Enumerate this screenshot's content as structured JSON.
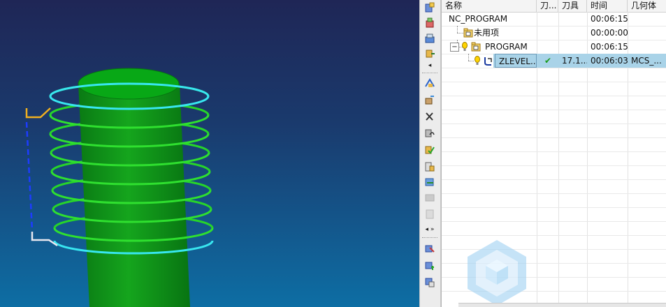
{
  "navigator": {
    "columns": [
      "名称",
      "刀...",
      "刀具",
      "时间",
      "几何体"
    ],
    "rows": [
      {
        "name": "NC_PROGRAM",
        "status": "",
        "tool": "",
        "time": "00:06:15",
        "geometry": ""
      },
      {
        "name": "未用项",
        "status": "",
        "tool": "",
        "time": "00:00:00",
        "geometry": ""
      },
      {
        "name": "PROGRAM",
        "status": "",
        "tool": "",
        "time": "00:06:15",
        "geometry": ""
      },
      {
        "name": "ZLEVEL...",
        "status": "✔",
        "tool": "17.1...",
        "time": "00:06:03",
        "geometry": "MCS_..."
      }
    ],
    "expand_toggle": "−"
  },
  "toolbar": {
    "chevron_top": "◂",
    "chevron_mid": "◂ »",
    "icons": [
      "create-program-icon",
      "create-tool-icon",
      "create-geometry-icon",
      "create-method-icon",
      "generate-toolpath-icon",
      "replay-toolpath-icon",
      "list-toolpath-icon",
      "verify-toolpath-icon",
      "simulate-machine-icon",
      "postprocess-icon",
      "shop-doc-icon",
      "output-cls-icon",
      "gouge-check-icon",
      "transform-object-icon",
      "display-object-icon",
      "import-tool-icon"
    ]
  },
  "colors": {
    "selection": "#a9d3e8",
    "part_green": "#0e8f1e",
    "toolpath_cyan": "#38e6f0",
    "toolpath_green": "#2fe02f",
    "approach_yellow": "#f0b020",
    "rapid_blue": "#1d3cff"
  }
}
